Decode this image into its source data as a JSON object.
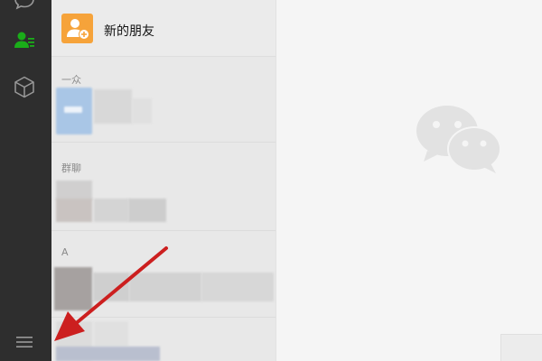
{
  "sidebar": {
    "icons": [
      {
        "name": "chat-icon",
        "color": "#9a9a9a"
      },
      {
        "name": "contacts-icon",
        "color": "#1aad19",
        "active": true
      },
      {
        "name": "favorites-cube-icon",
        "color": "#9a9a9a"
      },
      {
        "name": "menu-icon",
        "color": "#9a9a9a"
      }
    ]
  },
  "contacts": {
    "new_friends_label": "新的朋友",
    "new_friends_icon_color": "#f6a33a",
    "sections": [
      {
        "letter": "一众"
      },
      {
        "letter": "群聊"
      },
      {
        "letter": "A"
      }
    ]
  },
  "main": {
    "logo": "wechat-logo-icon"
  },
  "annotation": {
    "arrow_color": "#cc1f1f"
  }
}
